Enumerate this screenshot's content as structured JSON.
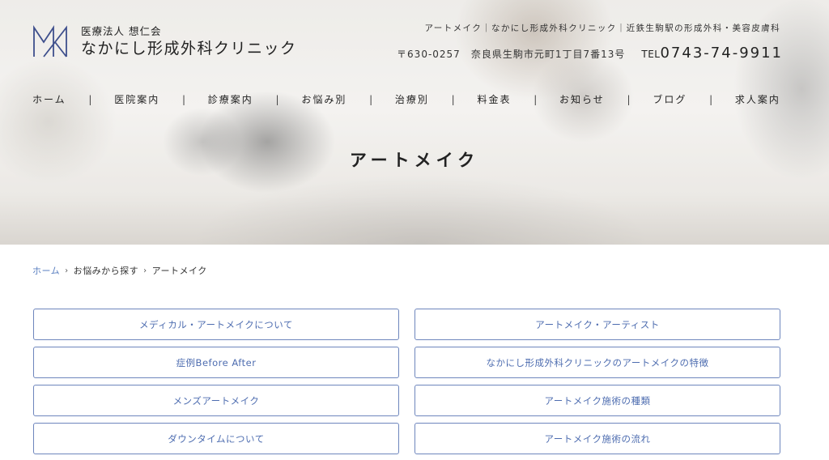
{
  "header": {
    "logo": {
      "sub": "医療法人 想仁会",
      "name": "なかにし形成外科クリニック",
      "icon": "nk-monogram-icon"
    },
    "tagline": "アートメイク｜なかにし形成外科クリニック｜近鉄生駒駅の形成外科・美容皮膚科",
    "address": "〒630-0257　奈良県生駒市元町1丁目7番13号",
    "tel_prefix": "TEL",
    "tel_number": "0743-74-9911"
  },
  "nav": {
    "items": [
      {
        "label": "ホーム"
      },
      {
        "label": "医院案内"
      },
      {
        "label": "診療案内"
      },
      {
        "label": "お悩み別"
      },
      {
        "label": "治療別"
      },
      {
        "label": "料金表"
      },
      {
        "label": "お知らせ"
      },
      {
        "label": "ブログ"
      },
      {
        "label": "求人案内"
      }
    ],
    "separator": "|"
  },
  "page": {
    "title": "アートメイク"
  },
  "breadcrumb": {
    "items": [
      "ホーム",
      "お悩みから探す",
      "アートメイク"
    ],
    "separator": "›"
  },
  "links": [
    {
      "label": "メディカル・アートメイクについて"
    },
    {
      "label": "アートメイク・アーティスト"
    },
    {
      "label": "症例Before After"
    },
    {
      "label": "なかにし形成外科クリニックのアートメイクの特徴"
    },
    {
      "label": "メンズアートメイク"
    },
    {
      "label": "アートメイク施術の種類"
    },
    {
      "label": "ダウンタイムについて"
    },
    {
      "label": "アートメイク施術の流れ"
    }
  ],
  "colors": {
    "accent": "#4e6db0",
    "border": "#6e86bd",
    "breadcrumb_link": "#5a7fc0",
    "logo": "#3e4f8c"
  }
}
